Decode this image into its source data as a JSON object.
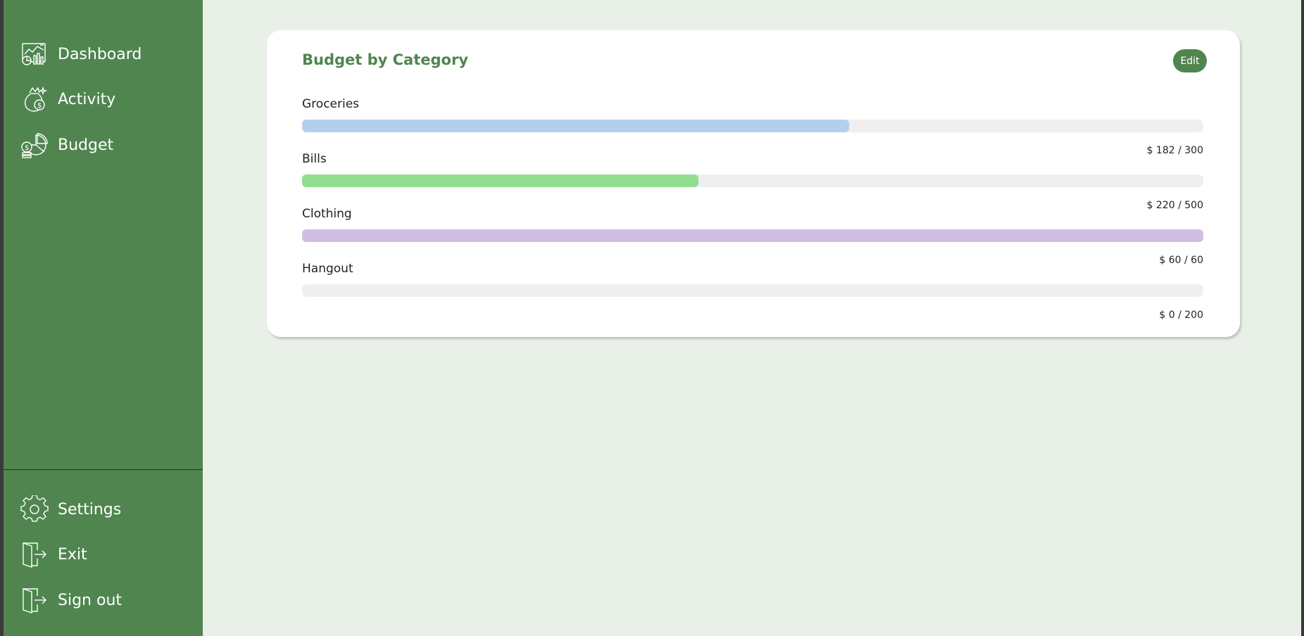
{
  "sidebar": {
    "top_items": [
      {
        "label": "Dashboard",
        "icon": "dashboard-icon"
      },
      {
        "label": "Activity",
        "icon": "money-bag-icon"
      },
      {
        "label": "Budget",
        "icon": "pie-chart-icon"
      }
    ],
    "bottom_items": [
      {
        "label": "Settings",
        "icon": "gear-icon"
      },
      {
        "label": "Exit",
        "icon": "exit-door-icon"
      },
      {
        "label": "Sign out",
        "icon": "sign-out-door-icon"
      }
    ]
  },
  "budget_card": {
    "title": "Budget by Category",
    "edit_label": "Edit",
    "categories": [
      {
        "name": "Groceries",
        "amount": "$ 182 / 300",
        "spent": 182,
        "limit": 300,
        "color": "#b3cff0"
      },
      {
        "name": "Bills",
        "amount": "$ 220 / 500",
        "spent": 220,
        "limit": 500,
        "color": "#90dd90"
      },
      {
        "name": "Clothing",
        "amount": "$ 60 / 60",
        "spent": 60,
        "limit": 60,
        "color": "#d2bde3"
      },
      {
        "name": "Hangout",
        "amount": "$ 0 / 200",
        "spent": 0,
        "limit": 200,
        "color": "#c0c0c0"
      }
    ]
  },
  "colors": {
    "sidebar": "#508550",
    "background": "#e9f0e8",
    "accent": "#508550",
    "track": "#efefef"
  }
}
